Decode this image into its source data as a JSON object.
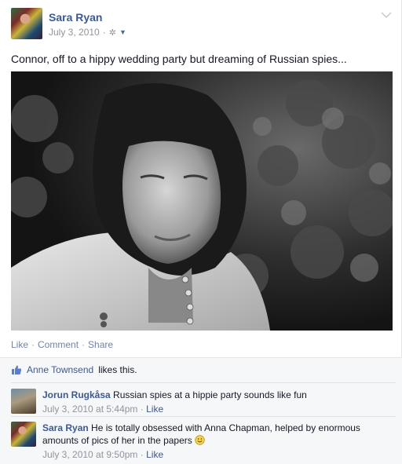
{
  "post": {
    "author": "Sara Ryan",
    "date": "July 3, 2010",
    "message": "Connor, off to a hippy wedding party but dreaming of Russian spies...",
    "actions": {
      "like": "Like",
      "comment": "Comment",
      "share": "Share"
    },
    "likes": {
      "name": "Anne Townsend",
      "suffix": "likes this."
    }
  },
  "comments": [
    {
      "author": "Jorun Rugkåsa",
      "text": "Russian spies at a hippie party sounds like fun",
      "timestamp": "July 3, 2010 at 5:44pm",
      "like_label": "Like"
    },
    {
      "author": "Sara Ryan",
      "text": "He is totally obsessed with Anna Chapman, helped by enormous amounts of pics of her in the papers",
      "timestamp": "July 3, 2010 at 9:50pm",
      "like_label": "Like"
    }
  ],
  "colors": {
    "link": "#3b5998",
    "meta": "#90949c",
    "background": "#f6f7f9"
  },
  "icons": [
    "gear-icon",
    "caret-down-icon",
    "chevron-down-icon",
    "thumbs-up-icon",
    "smiley-icon"
  ]
}
